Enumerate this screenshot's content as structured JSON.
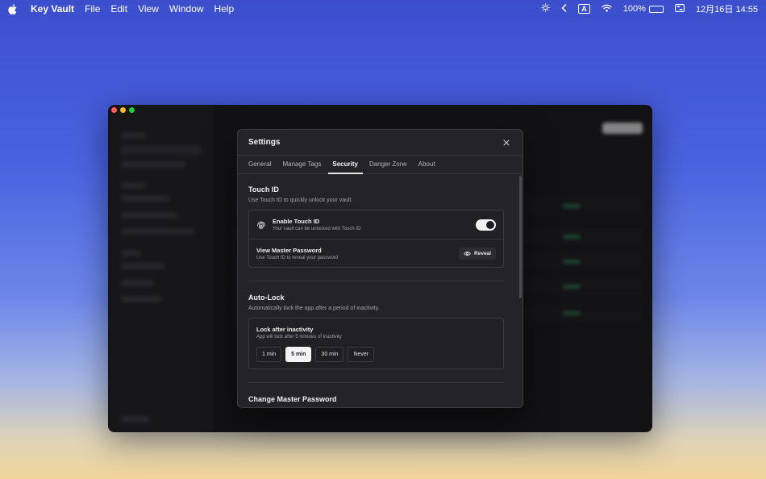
{
  "menubar": {
    "app_name": "Key Vault",
    "menus": [
      "File",
      "Edit",
      "View",
      "Window",
      "Help"
    ],
    "input_source": "A",
    "battery": "100%",
    "battery_level": 1.0,
    "clock": "12月16日  14:55"
  },
  "settings": {
    "title": "Settings",
    "tabs": [
      "General",
      "Manage Tags",
      "Security",
      "Danger Zone",
      "About"
    ],
    "active_tab": "Security",
    "touch_id": {
      "title": "Touch ID",
      "description": "Use Touch ID to quickly unlock your vault.",
      "enable_label": "Enable Touch ID",
      "enable_sub": "Your vault can be unlocked with Touch ID",
      "enabled": true,
      "view_label": "View Master Password",
      "view_sub": "Use Touch ID to reveal your password",
      "reveal_label": "Reveal"
    },
    "auto_lock": {
      "title": "Auto-Lock",
      "description": "Automatically lock the app after a period of inactivity.",
      "card_label": "Lock after inactivity",
      "card_sub": "App will lock after 5 minutes of inactivity",
      "options": [
        "1 min",
        "5 min",
        "30 min",
        "Never"
      ],
      "selected": "5 min"
    },
    "change_password_title": "Change Master Password"
  },
  "colors": {
    "accent": "#f4f4f6",
    "panel_bg": "#242428",
    "status_green": "#2f6b4a"
  }
}
